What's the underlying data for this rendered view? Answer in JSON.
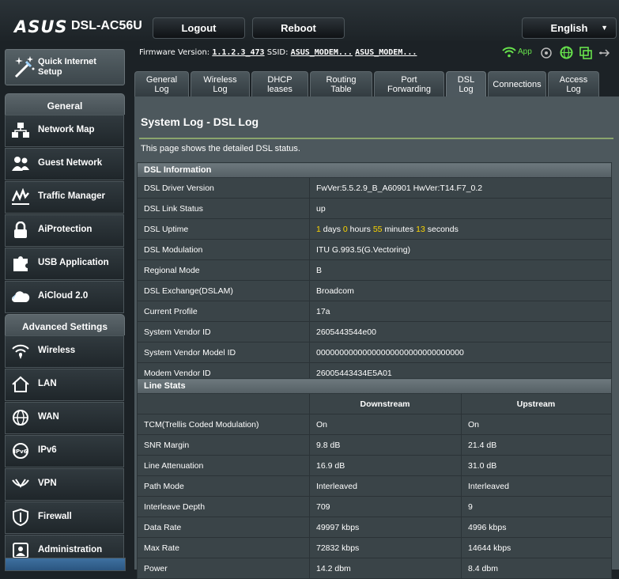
{
  "header": {
    "brand": "ASUS",
    "model": "DSL-AC56U",
    "logout_label": "Logout",
    "reboot_label": "Reboot",
    "language": "English"
  },
  "firmware": {
    "label": "Firmware Version:",
    "version": "1.1.2.3_473",
    "ssid_label": "SSID:",
    "ssid1": "ASUS_MODEM...",
    "ssid2": "ASUS_MODEM..."
  },
  "status_icons": {
    "app_label": "App",
    "icons": [
      "wifi-icon",
      "app-icon",
      "globe-icon",
      "usb-storage-icon",
      "usb-icon"
    ],
    "accent": "#67e24c"
  },
  "sidebar": {
    "qis_label": "Quick Internet Setup",
    "general_title": "General",
    "general_items": [
      {
        "label": "Network Map",
        "icon": "network-map-icon"
      },
      {
        "label": "Guest Network",
        "icon": "guest-network-icon"
      },
      {
        "label": "Traffic Manager",
        "icon": "traffic-manager-icon"
      },
      {
        "label": "AiProtection",
        "icon": "lock-icon"
      },
      {
        "label": "USB Application",
        "icon": "puzzle-icon"
      },
      {
        "label": "AiCloud 2.0",
        "icon": "cloud-icon"
      }
    ],
    "advanced_title": "Advanced Settings",
    "advanced_items": [
      {
        "label": "Wireless",
        "icon": "wireless-icon"
      },
      {
        "label": "LAN",
        "icon": "home-icon"
      },
      {
        "label": "WAN",
        "icon": "globe-icon"
      },
      {
        "label": "IPv6",
        "icon": "ipv6-icon"
      },
      {
        "label": "VPN",
        "icon": "vpn-icon"
      },
      {
        "label": "Firewall",
        "icon": "shield-icon"
      },
      {
        "label": "Administration",
        "icon": "admin-icon"
      }
    ]
  },
  "tabs": [
    {
      "label": "General Log",
      "active": false
    },
    {
      "label": "Wireless Log",
      "active": false
    },
    {
      "label": "DHCP leases",
      "active": false
    },
    {
      "label": "Routing Table",
      "active": false
    },
    {
      "label": "Port Forwarding",
      "active": false
    },
    {
      "label": "DSL Log",
      "active": true
    },
    {
      "label": "Connections",
      "active": false
    },
    {
      "label": "Access Log",
      "active": false
    }
  ],
  "page": {
    "title": "System Log - DSL Log",
    "description": "This page shows the detailed DSL status."
  },
  "dsl_info": {
    "title": "DSL Information",
    "rows": [
      {
        "label": "DSL Driver Version",
        "value": "FwVer:5.5.2.9_B_A60901 HwVer:T14.F7_0.2"
      },
      {
        "label": "DSL Link Status",
        "value": "up"
      },
      {
        "label": "DSL Uptime",
        "uptime": {
          "days": "1",
          "days_unit": "days",
          "hours": "0",
          "hours_unit": "hours",
          "minutes": "55",
          "minutes_unit": "minutes",
          "seconds": "13",
          "seconds_unit": "seconds"
        }
      },
      {
        "label": "DSL Modulation",
        "value": "ITU G.993.5(G.Vectoring)"
      },
      {
        "label": "Regional Mode",
        "value": "B"
      },
      {
        "label": "DSL Exchange(DSLAM)",
        "value": "Broadcom"
      },
      {
        "label": "Current Profile",
        "value": "17a"
      },
      {
        "label": "System Vendor ID",
        "value": "2605443544e00"
      },
      {
        "label": "System Vendor Model ID",
        "value": "00000000000000000000000000000000"
      },
      {
        "label": "Modem Vendor ID",
        "value": "26005443434E5A01"
      }
    ]
  },
  "line_stats": {
    "title": "Line Stats",
    "col_down": "Downstream",
    "col_up": "Upstream",
    "rows": [
      {
        "label": "TCM(Trellis Coded Modulation)",
        "down": "On",
        "up": "On"
      },
      {
        "label": "SNR Margin",
        "down": "9.8 dB",
        "up": "21.4 dB"
      },
      {
        "label": "Line Attenuation",
        "down": "16.9 dB",
        "up": "31.0 dB"
      },
      {
        "label": "Path Mode",
        "down": "Interleaved",
        "up": "Interleaved"
      },
      {
        "label": "Interleave Depth",
        "down": "709",
        "up": "9"
      },
      {
        "label": "Data Rate",
        "down": "49997 kbps",
        "up": "4996 kbps"
      },
      {
        "label": "Max Rate",
        "down": "72832 kbps",
        "up": "14644 kbps"
      },
      {
        "label": "Power",
        "down": "14.2 dbm",
        "up": "8.4 dbm"
      }
    ]
  }
}
